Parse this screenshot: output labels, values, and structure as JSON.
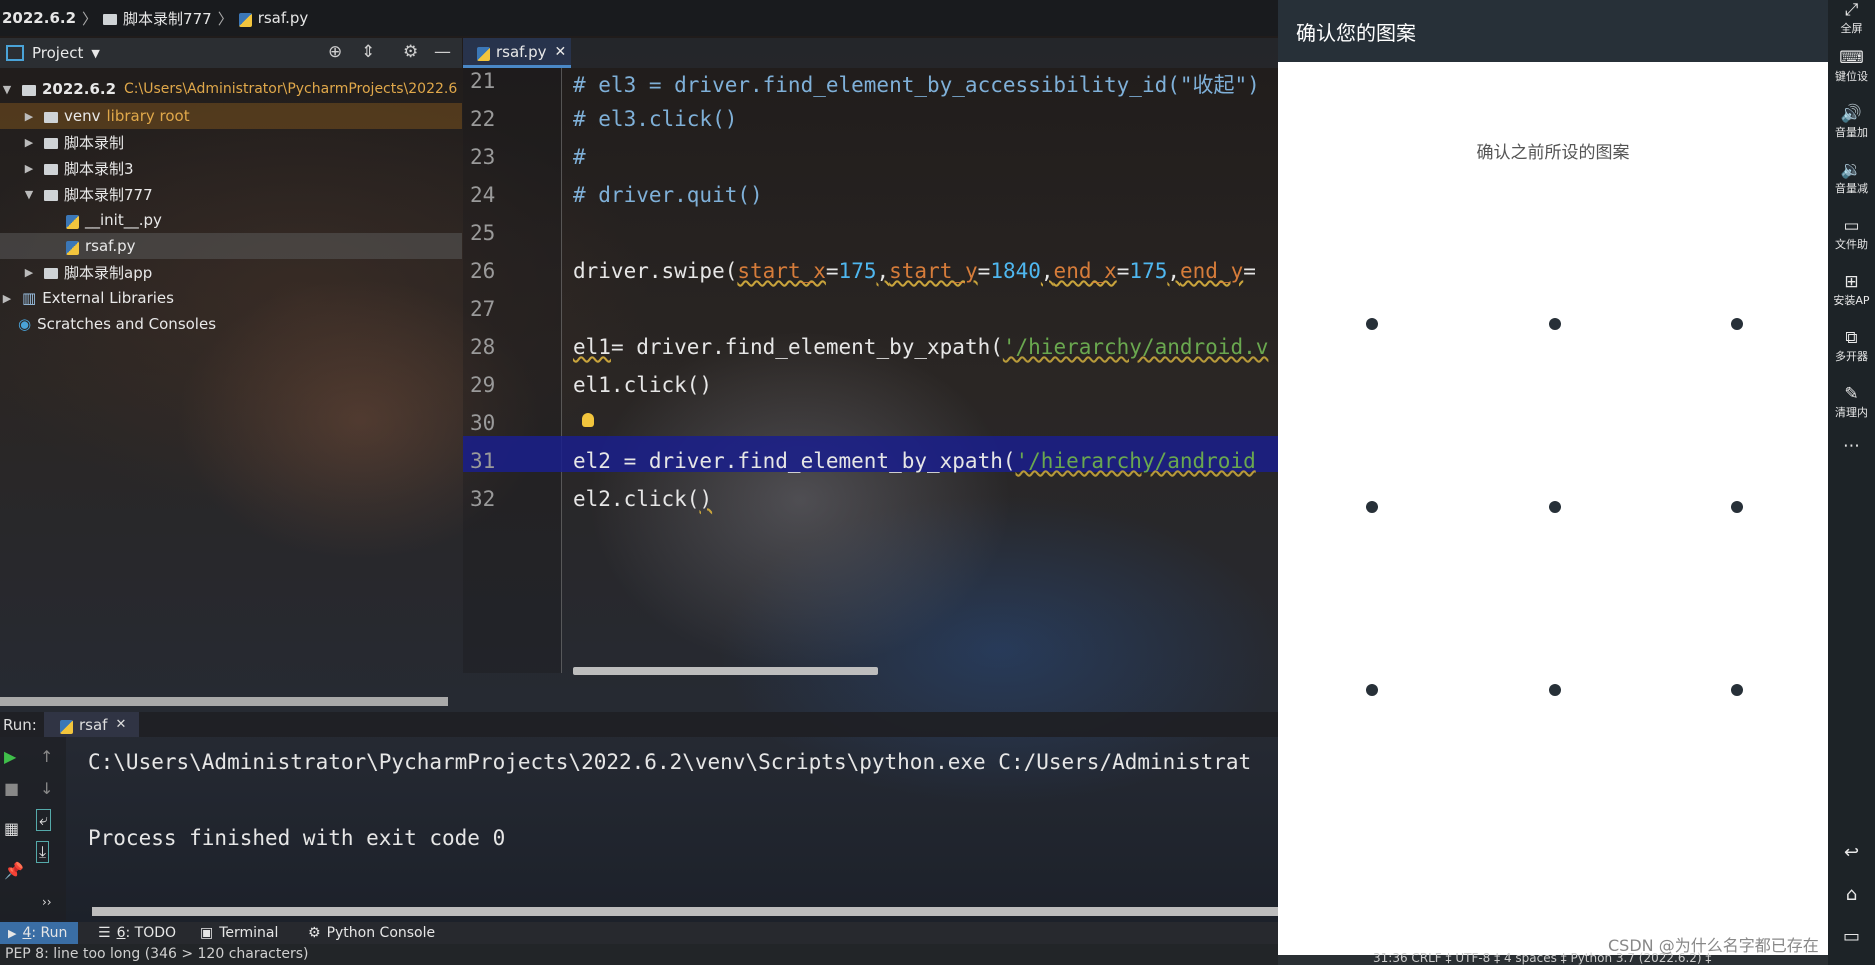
{
  "breadcrumb": {
    "project": "2022.6.2",
    "folder": "脚本录制777",
    "file": "rsaf.py"
  },
  "project_panel": {
    "title": "Project",
    "tree": [
      {
        "label": "2022.6.2",
        "extra": "C:\\Users\\Administrator\\PycharmProjects\\2022.6",
        "kind": "folder",
        "expanded": true
      },
      {
        "label": "venv",
        "extra": "library root",
        "kind": "folder"
      },
      {
        "label": "脚本录制",
        "kind": "folder"
      },
      {
        "label": "脚本录制3",
        "kind": "folder"
      },
      {
        "label": "脚本录制777",
        "kind": "folder",
        "expanded": true
      },
      {
        "label": "__init__.py",
        "kind": "file"
      },
      {
        "label": "rsaf.py",
        "kind": "file"
      },
      {
        "label": "脚本录制app",
        "kind": "folder"
      },
      {
        "label": "External Libraries",
        "kind": "library"
      },
      {
        "label": "Scratches and Consoles",
        "kind": "scratch"
      }
    ]
  },
  "editor": {
    "tab": "rsaf.py",
    "lines": [
      {
        "n": "21",
        "text": "# el3 = driver.find_element_by_accessibility_id(\"收起\")"
      },
      {
        "n": "22",
        "text": "# el3.click()"
      },
      {
        "n": "23",
        "text": "#"
      },
      {
        "n": "24",
        "text": "# driver.quit()"
      },
      {
        "n": "25",
        "text": ""
      },
      {
        "n": "26",
        "p1": "driver.swipe(",
        "k1": "start_x",
        "v1": "175",
        "k2": "start_y",
        "v2": "1840",
        "k3": "end_x",
        "v3": "175",
        "k4": "end_y"
      },
      {
        "n": "27",
        "text": ""
      },
      {
        "n": "28",
        "p1": "el1",
        "p2": "= driver.find_element_by_xpath(",
        "s": "'/hierarchy/android.v"
      },
      {
        "n": "29",
        "text": "el1.click()"
      },
      {
        "n": "30",
        "text": ""
      },
      {
        "n": "31",
        "p1": "el2 = driver.find_element_by_xpath(",
        "s": "'/hierarchy/android"
      },
      {
        "n": "32",
        "text": "el2.click()"
      }
    ]
  },
  "run_panel": {
    "label": "Run:",
    "tab": "rsaf",
    "output": [
      "C:\\Users\\Administrator\\PycharmProjects\\2022.6.2\\venv\\Scripts\\python.exe C:/Users/Administrat",
      "",
      "Process finished with exit code 0"
    ]
  },
  "bottom_tabs": [
    {
      "num": "4",
      "label": ": Run"
    },
    {
      "num": "6",
      "label": ": TODO"
    },
    {
      "num": "",
      "label": "Terminal"
    },
    {
      "num": "",
      "label": "Python Console"
    }
  ],
  "status": {
    "message": "PEP 8: line too long (346 > 120 characters)",
    "right": "31:36   CRLF ‡   UTF-8 ‡   4 spaces ‡   Python 3.7 (2022.6.2) ‡"
  },
  "phone": {
    "header": "确认您的图案",
    "subtitle": "确认之前所设的图案",
    "grid": [
      [
        1,
        1,
        1
      ],
      [
        1,
        1,
        1
      ],
      [
        1,
        1,
        1
      ]
    ]
  },
  "emulator_sidebar": [
    {
      "icon": "⤢",
      "label": "全屏"
    },
    {
      "icon": "⌨",
      "label": "键位设"
    },
    {
      "icon": "🔊",
      "label": "音量加"
    },
    {
      "icon": "🔉",
      "label": "音量减"
    },
    {
      "icon": "▭",
      "label": "文件助"
    },
    {
      "icon": "⊞",
      "label": "安装AP"
    },
    {
      "icon": "⧉",
      "label": "多开器"
    },
    {
      "icon": "✎",
      "label": "清理内"
    },
    {
      "icon": "⋯",
      "label": ""
    }
  ],
  "emulator_nav": [
    "↩",
    "⌂",
    "▭"
  ],
  "watermark": "CSDN @为什么名字都已存在"
}
